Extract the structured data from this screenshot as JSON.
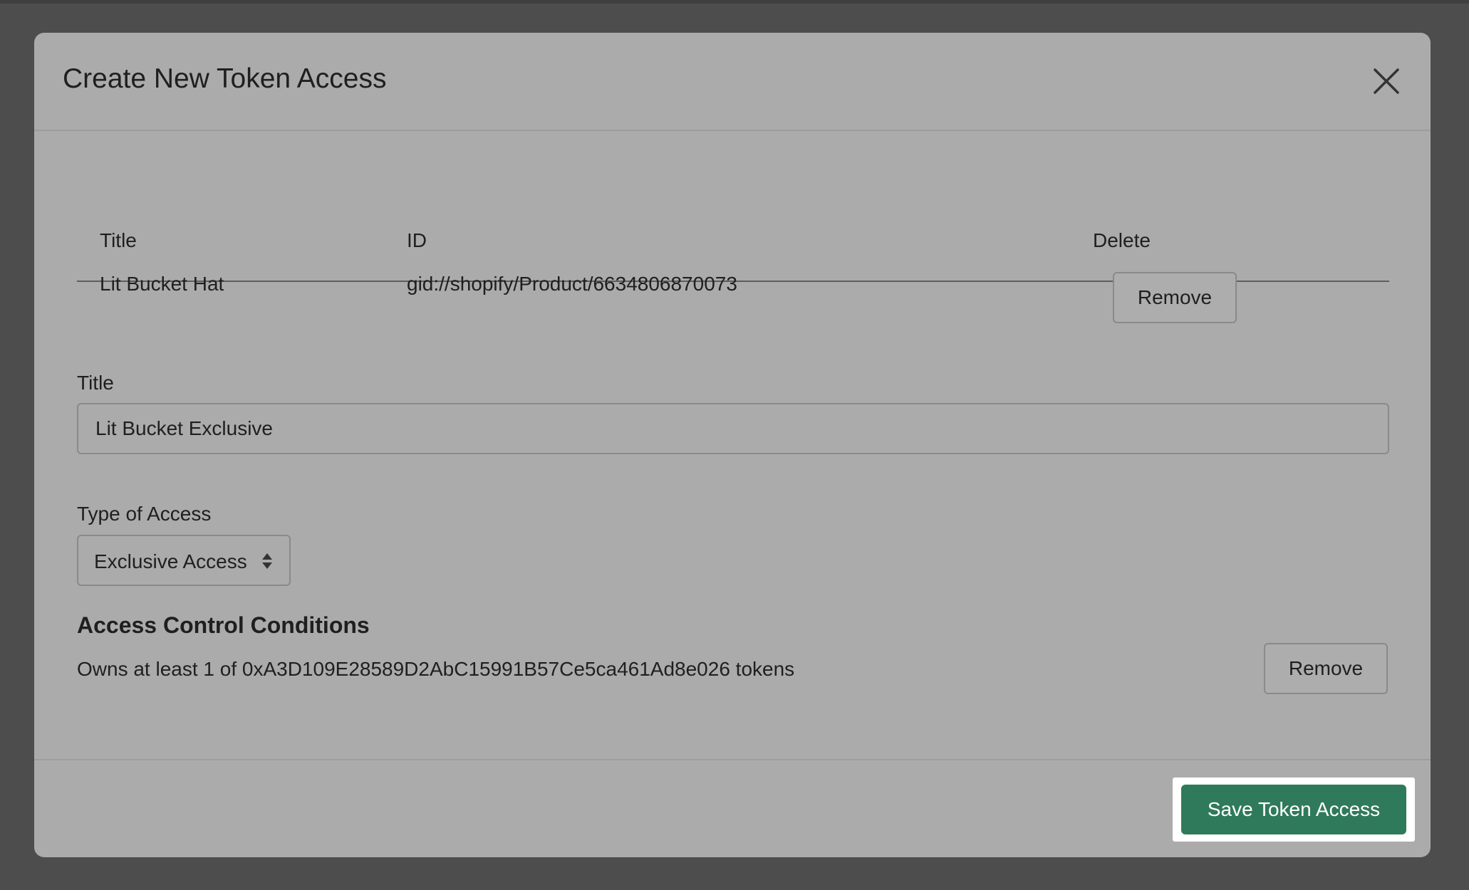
{
  "modal": {
    "title": "Create New Token Access",
    "close_icon": "close-icon"
  },
  "table": {
    "headers": [
      "Title",
      "ID",
      "Delete"
    ],
    "rows": [
      {
        "title": "Lit Bucket Hat",
        "id": "gid://shopify/Product/6634806870073",
        "remove_label": "Remove"
      }
    ]
  },
  "title_field": {
    "label": "Title",
    "value": "Lit Bucket Exclusive"
  },
  "access_type": {
    "label": "Type of Access",
    "selected": "Exclusive Access",
    "icon": "select-arrows-icon"
  },
  "conditions": {
    "heading": "Access Control Conditions",
    "items": [
      {
        "text": "Owns at least 1 of 0xA3D109E28589D2AbC15991B57Ce5ca461Ad8e026 tokens",
        "remove_label": "Remove"
      }
    ]
  },
  "footer": {
    "save_label": "Save Token Access"
  },
  "colors": {
    "overlay": "#4d4d4d",
    "modal_bg": "#ababab",
    "primary": "#2f7a5a",
    "highlight": "#ffffff"
  }
}
